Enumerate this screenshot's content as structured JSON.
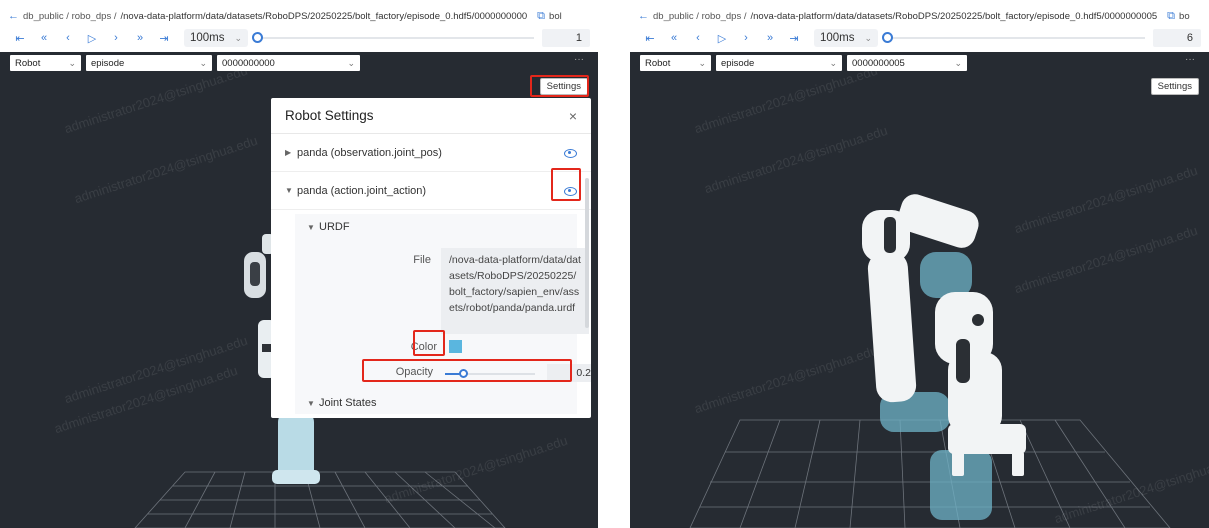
{
  "left": {
    "breadcrumb": {
      "back_icon": "arrow-left-icon",
      "path_prefix": "db_public / robo_dps / ",
      "path_main": "/nova-data-platform/data/datasets/RoboDPS/20250225/bolt_factory/episode_0.hdf5/0000000000",
      "copy_icon": "copy-icon",
      "trailing": "bol"
    },
    "toolbar": {
      "speed_label": "100ms",
      "frame_value": "1",
      "progress": 0.0
    },
    "selectors": {
      "robot": "Robot",
      "episode": "episode",
      "frame": "0000000000"
    },
    "more_label": "···",
    "settings_label": "Settings",
    "dialog": {
      "title": "Robot Settings",
      "close_label": "×",
      "robot_obs_label": "panda (observation.joint_pos)",
      "robot_act_label": "panda (action.joint_action)",
      "urdf_label": "URDF",
      "file_key": "File",
      "file_value": "/nova-data-platform/data/datasets/RoboDPS/20250225/bolt_factory/sapien_env/assets/robot/panda/panda.urdf",
      "color_key": "Color",
      "color_value": "#5ab6df",
      "opacity_key": "Opacity",
      "opacity_value": "0.2",
      "opacity_fraction": 0.2,
      "joint_states_label": "Joint States"
    },
    "watermark": "administrator2024@tsinghua.edu"
  },
  "right": {
    "breadcrumb": {
      "back_icon": "arrow-left-icon",
      "path_prefix": "db_public / robo_dps / ",
      "path_main": "/nova-data-platform/data/datasets/RoboDPS/20250225/bolt_factory/episode_0.hdf5/0000000005",
      "copy_icon": "copy-icon",
      "trailing": "bo"
    },
    "toolbar": {
      "speed_label": "100ms",
      "frame_value": "6",
      "progress": 0.0
    },
    "selectors": {
      "robot": "Robot",
      "episode": "episode",
      "frame": "0000000005"
    },
    "more_label": "···",
    "settings_label": "Settings",
    "watermark": "administrator2024@tsinghua.edu"
  },
  "colors": {
    "viewer_bg": "#262b32",
    "accent": "#3a7bd5",
    "highlight": "#e3271b",
    "robot_ghost": "#5ab6df"
  }
}
